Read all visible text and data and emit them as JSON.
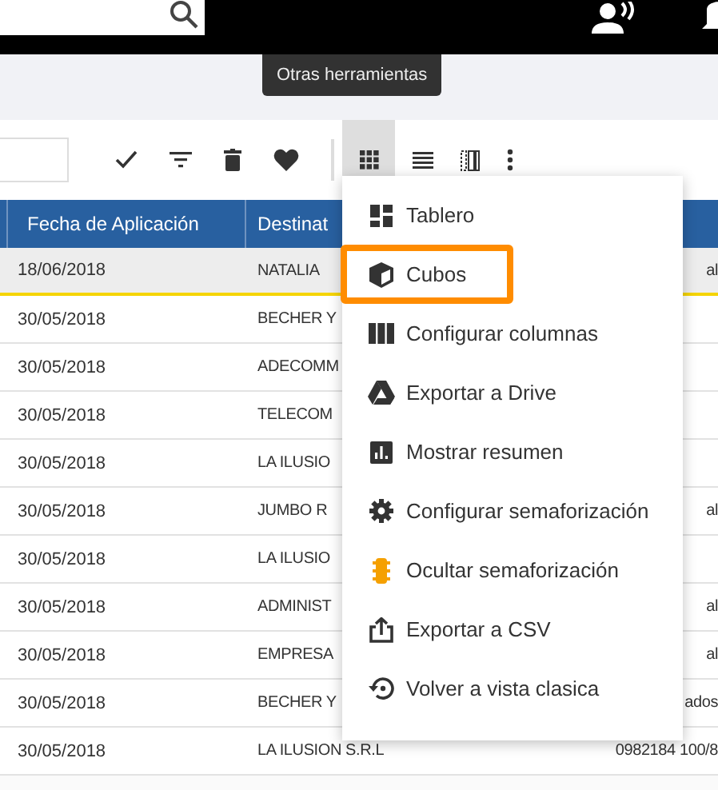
{
  "tooltip": "Otras herramientas",
  "toolbar": {
    "grid_view_selected": true
  },
  "table": {
    "columns": [
      "Fecha de Aplicación",
      "Destinat"
    ],
    "rows": [
      {
        "date": "18/06/2018",
        "name": "NATALIA",
        "column_3": "al",
        "selected": true
      },
      {
        "date": "30/05/2018",
        "name": "BECHER Y",
        "column_3": "",
        "selected": false
      },
      {
        "date": "30/05/2018",
        "name": "ADECOMM",
        "column_3": "",
        "selected": false
      },
      {
        "date": "30/05/2018",
        "name": "TELECOM",
        "column_3": "",
        "selected": false
      },
      {
        "date": "30/05/2018",
        "name": "LA ILUSIO",
        "column_3": "",
        "selected": false
      },
      {
        "date": "30/05/2018",
        "name": "JUMBO R",
        "column_3": "al",
        "selected": false
      },
      {
        "date": "30/05/2018",
        "name": "LA ILUSIO",
        "column_3": "",
        "selected": false
      },
      {
        "date": "30/05/2018",
        "name": "ADMINIST",
        "column_3": "al",
        "selected": false
      },
      {
        "date": "30/05/2018",
        "name": "EMPRESA",
        "column_3": "al",
        "selected": false
      },
      {
        "date": "30/05/2018",
        "name": "BECHER Y",
        "column_3": "ados",
        "selected": false
      },
      {
        "date": "30/05/2018",
        "name": "LA ILUSION S.R.L",
        "column_3": "0982184 100/8",
        "selected": false
      }
    ]
  },
  "menu": [
    {
      "kind": "dashboard",
      "label": "Tablero",
      "highlighted": false
    },
    {
      "kind": "cube",
      "label": "Cubos",
      "highlighted": true
    },
    {
      "kind": "columns",
      "label": "Configurar columnas",
      "highlighted": false
    },
    {
      "kind": "drive",
      "label": "Exportar a Drive",
      "highlighted": false
    },
    {
      "kind": "chart",
      "label": "Mostrar resumen",
      "highlighted": false
    },
    {
      "kind": "gear",
      "label": "Configurar semaforización",
      "highlighted": false
    },
    {
      "kind": "traffic",
      "label": "Ocultar semaforización",
      "highlighted": false
    },
    {
      "kind": "export",
      "label": "Exportar a CSV",
      "highlighted": false
    },
    {
      "kind": "restore",
      "label": "Volver a vista clasica",
      "highlighted": false
    }
  ]
}
